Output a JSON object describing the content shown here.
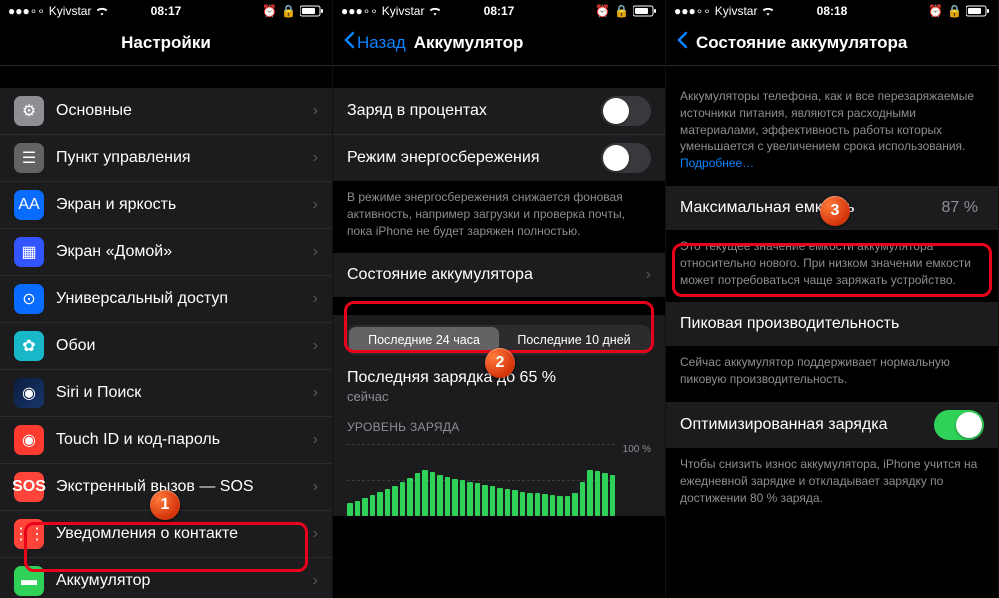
{
  "screens": [
    {
      "status": {
        "carrier": "Kyivstar",
        "time": "08:17"
      },
      "title": "Настройки",
      "items": [
        {
          "label": "Основные",
          "icon": "gear",
          "cls": "ic-gray"
        },
        {
          "label": "Пункт управления",
          "icon": "toggles",
          "cls": "ic-gray2"
        },
        {
          "label": "Экран и яркость",
          "icon": "aa",
          "cls": "ic-blue"
        },
        {
          "label": "Экран «Домой»",
          "icon": "grid",
          "cls": "ic-indigo"
        },
        {
          "label": "Универсальный доступ",
          "icon": "person",
          "cls": "ic-blue"
        },
        {
          "label": "Обои",
          "icon": "flower",
          "cls": "ic-teal"
        },
        {
          "label": "Siri и Поиск",
          "icon": "siri",
          "cls": "ic-siri"
        },
        {
          "label": "Touch ID и код-пароль",
          "icon": "finger",
          "cls": "ic-red"
        },
        {
          "label": "Экстренный вызов — SOS",
          "icon": "sos",
          "cls": "ic-sos"
        },
        {
          "label": "Уведомления о контакте",
          "icon": "dots",
          "cls": "ic-redwt"
        },
        {
          "label": "Аккумулятор",
          "icon": "battery",
          "cls": "ic-green"
        }
      ]
    },
    {
      "status": {
        "carrier": "Kyivstar",
        "time": "08:17"
      },
      "back": "Назад",
      "title": "Аккумулятор",
      "toggles": [
        {
          "label": "Заряд в процентах",
          "on": false
        },
        {
          "label": "Режим энергосбережения",
          "on": false
        }
      ],
      "toggle_footer": "В режиме энергосбережения снижается фоновая активность, например загрузки и проверка почты, пока iPhone не будет заряжен полностью.",
      "state_row": "Состояние аккумулятора",
      "seg": {
        "a": "Последние 24 часа",
        "b": "Последние 10 дней",
        "selected": "a"
      },
      "last_charge": {
        "title": "Последняя зарядка до 65 %",
        "sub": "сейчас"
      },
      "chart_label": "УРОВЕНЬ ЗАРЯДА",
      "chart_max": "100 %"
    },
    {
      "status": {
        "carrier": "Kyivstar",
        "time": "08:18"
      },
      "title": "Состояние аккумулятора",
      "intro": "Аккумуляторы телефона, как и все перезаряжаемые источники питания, являются расходными материалами, эффективность работы которых уменьшается с увеличением срока использования.",
      "intro_link": "Подробнее…",
      "max_cap": {
        "label": "Максимальная емкость",
        "value": "87 %"
      },
      "max_footer": "Это текущее значение емкости аккумулятора относительно нового. При низком значении емкости может потребоваться чаще заряжать устройство.",
      "peak_label": "Пиковая производительность",
      "peak_footer": "Сейчас аккумулятор поддерживает нормальную пиковую производительность.",
      "opt_label": "Оптимизированная зарядка",
      "opt_on": true,
      "opt_footer": "Чтобы снизить износ аккумулятора, iPhone учится на ежедневной зарядке и откладывает зарядку по достижении 80 % заряда."
    }
  ],
  "chart_data": {
    "type": "bar",
    "title": "УРОВЕНЬ ЗАРЯДА",
    "ylabel": "%",
    "ylim": [
      0,
      100
    ],
    "values": [
      18,
      22,
      26,
      30,
      34,
      38,
      42,
      48,
      54,
      60,
      65,
      62,
      58,
      55,
      52,
      50,
      48,
      46,
      44,
      42,
      40,
      38,
      36,
      34,
      33,
      32,
      31,
      30,
      29,
      28,
      32,
      48,
      65,
      63,
      60,
      58
    ],
    "y_ticks": [
      50,
      100
    ]
  }
}
